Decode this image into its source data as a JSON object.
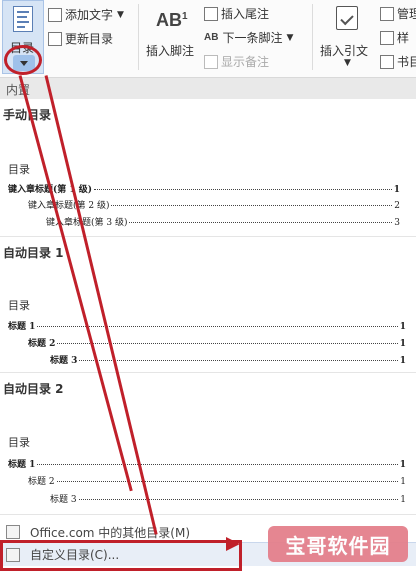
{
  "ribbon": {
    "toc_label": "目录",
    "add_text": "添加文字",
    "update_toc": "更新目录",
    "insert_footnote": "插入脚注",
    "insert_endnote": "插入尾注",
    "next_footnote": "下一条脚注",
    "show_notes": "显示备注",
    "insert_citation": "插入引文",
    "manage_sources": "管理",
    "style": "样",
    "bibliography": "书目",
    "ab_big": "AB",
    "ab_sup": "1",
    "ab_small": "AB"
  },
  "gallery": {
    "section_header": "内置",
    "manual": {
      "title": "手动目录",
      "heading": "目录",
      "lines": [
        {
          "text": "键入章标题(第 1 级)",
          "page": "1"
        },
        {
          "text": "键入章标题(第 2 级)",
          "page": "2"
        },
        {
          "text": "键入章标题(第 3 级)",
          "page": "3"
        }
      ]
    },
    "auto1": {
      "title": "自动目录 1",
      "heading": "目录",
      "lines": [
        {
          "text": "标题 1",
          "page": "1"
        },
        {
          "text": "标题 2",
          "page": "1"
        },
        {
          "text": "标题 3",
          "page": "1"
        }
      ]
    },
    "auto2": {
      "title": "自动目录 2",
      "heading": "目录",
      "lines": [
        {
          "text": "标题 1",
          "page": "1"
        },
        {
          "text": "标题 2",
          "page": "1"
        },
        {
          "text": "标题 3",
          "page": "1"
        }
      ]
    }
  },
  "menu": {
    "office_more": "Office.com 中的其他目录(M)",
    "custom_toc": "自定义目录(C)..."
  },
  "watermark": "宝哥软件园",
  "colors": {
    "annotation_red": "#c0202a",
    "watermark_pink": "#e4808c"
  }
}
